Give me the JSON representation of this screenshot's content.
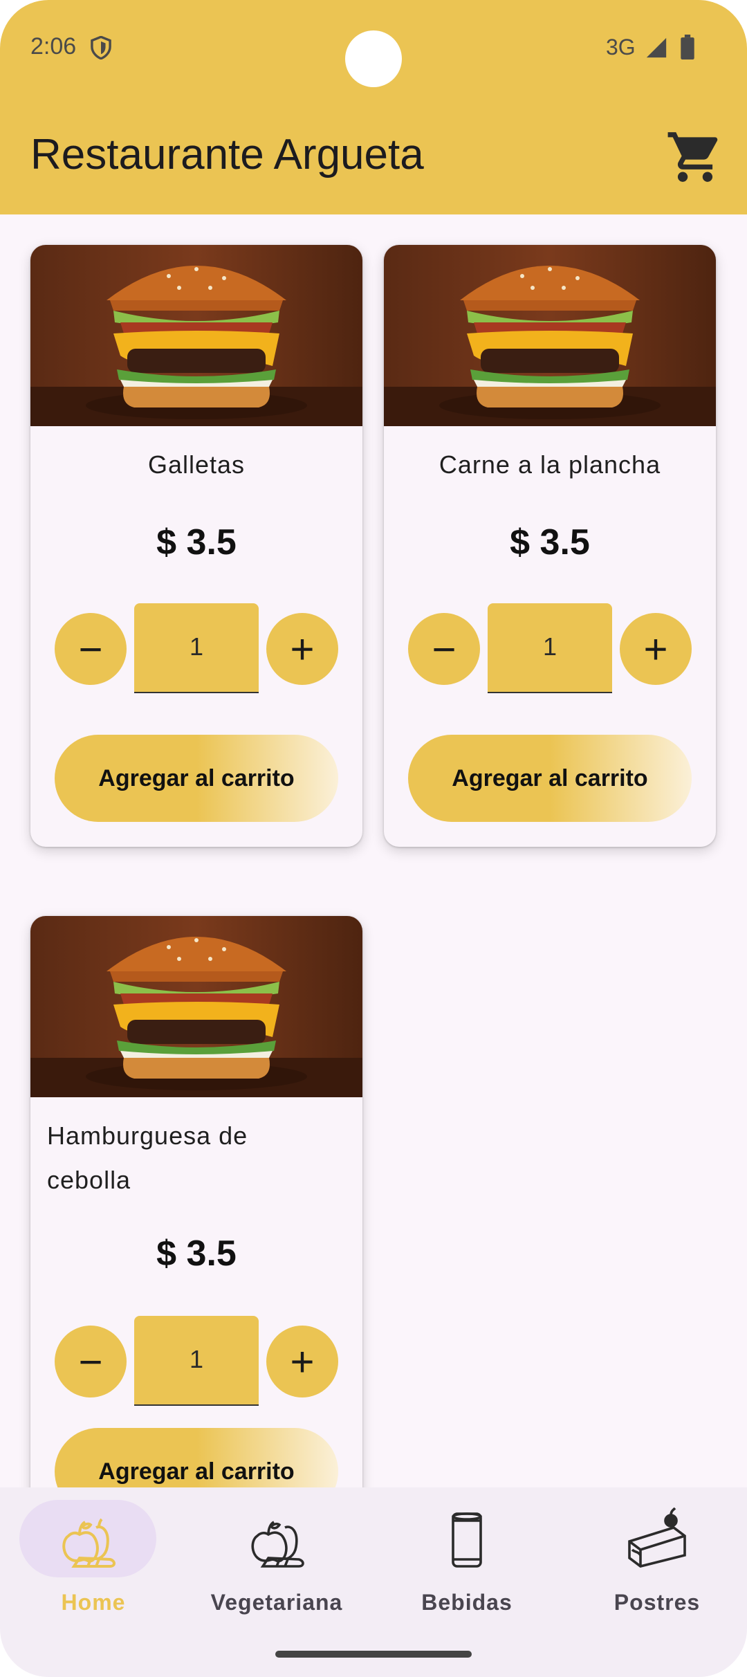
{
  "status_bar": {
    "time": "2:06",
    "network": "3G"
  },
  "app_bar": {
    "title": "Restaurante Argueta",
    "cart_icon": "shopping-cart-icon"
  },
  "colors": {
    "accent": "#ebc453",
    "background": "#fbf5fb",
    "nav_bg": "#f3edf5",
    "nav_active_pill": "#e9ddf3"
  },
  "products": [
    {
      "name": "Galletas",
      "price": "$ 3.5",
      "quantity": "1",
      "decrement": "−",
      "increment": "+",
      "add_label": "Agregar al carrito"
    },
    {
      "name": "Carne a la plancha",
      "price": "$ 3.5",
      "quantity": "1",
      "decrement": "−",
      "increment": "+",
      "add_label": "Agregar al carrito"
    },
    {
      "name": "Hamburguesa de cebolla",
      "price": "$ 3.5",
      "quantity": "1",
      "decrement": "−",
      "increment": "+",
      "add_label": "Agregar al carrito"
    }
  ],
  "bottom_nav": {
    "items": [
      {
        "label": "Home",
        "icon": "fruits-icon",
        "active": true
      },
      {
        "label": "Vegetariana",
        "icon": "vegetables-icon",
        "active": false
      },
      {
        "label": "Bebidas",
        "icon": "can-icon",
        "active": false
      },
      {
        "label": "Postres",
        "icon": "cake-icon",
        "active": false
      }
    ]
  }
}
